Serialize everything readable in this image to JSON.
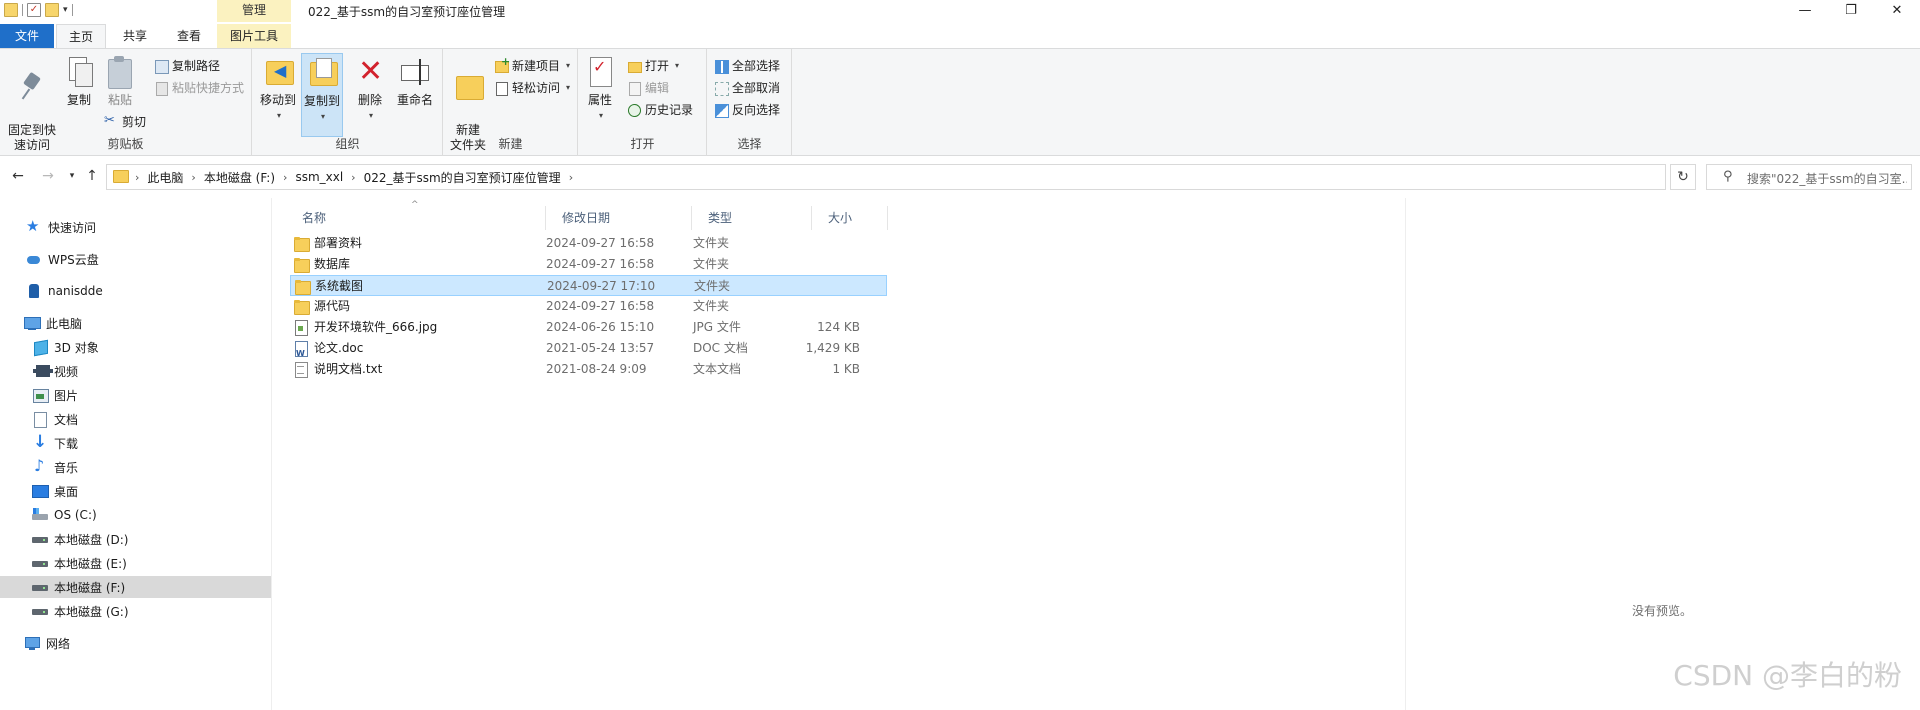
{
  "window": {
    "title": "022_基于ssm的自习室预订座位管理",
    "context_tab_group": "管理",
    "controls": {
      "minimize": "—",
      "maximize": "❐",
      "close": "✕"
    }
  },
  "ribbon_tabs": [
    {
      "label": "文件"
    },
    {
      "label": "主页"
    },
    {
      "label": "共享"
    },
    {
      "label": "查看"
    },
    {
      "label": "图片工具"
    }
  ],
  "ribbon": {
    "clipboard": {
      "label": "剪贴板",
      "pin": "固定到快\n速访问",
      "copy": "复制",
      "paste": "粘贴",
      "copy_path": "复制路径",
      "paste_shortcut": "粘贴快捷方式",
      "cut": "剪切"
    },
    "organize": {
      "label": "组织",
      "move_to": "移动到",
      "copy_to": "复制到",
      "delete": "删除",
      "rename": "重命名"
    },
    "new": {
      "label": "新建",
      "new_folder": "新建\n文件夹",
      "new_item": "新建项目",
      "easy_access": "轻松访问"
    },
    "open": {
      "label": "打开",
      "properties": "属性",
      "open": "打开",
      "edit": "编辑",
      "history": "历史记录"
    },
    "select": {
      "label": "选择",
      "select_all": "全部选择",
      "select_none": "全部取消",
      "invert": "反向选择"
    }
  },
  "address": {
    "crumbs": [
      "此电脑",
      "本地磁盘 (F:)",
      "ssm_xxl",
      "022_基于ssm的自习室预订座位管理"
    ],
    "search_placeholder": "搜索\"022_基于ssm的自习室..."
  },
  "nav_pane": {
    "items": [
      {
        "label": "快速访问",
        "icon": "star-icon"
      },
      {
        "label": "WPS云盘",
        "icon": "cloud-icon"
      },
      {
        "label": "nanisdde",
        "icon": "user-folder-icon"
      },
      {
        "label": "此电脑",
        "icon": "computer-icon"
      },
      {
        "label": "3D 对象",
        "icon": "3d-objects-icon"
      },
      {
        "label": "视频",
        "icon": "video-icon"
      },
      {
        "label": "图片",
        "icon": "pictures-icon"
      },
      {
        "label": "文档",
        "icon": "documents-icon"
      },
      {
        "label": "下载",
        "icon": "download-icon"
      },
      {
        "label": "音乐",
        "icon": "music-icon"
      },
      {
        "label": "桌面",
        "icon": "desktop-icon"
      },
      {
        "label": "OS (C:)",
        "icon": "os-drive-icon"
      },
      {
        "label": "本地磁盘 (D:)",
        "icon": "drive-icon"
      },
      {
        "label": "本地磁盘 (E:)",
        "icon": "drive-icon"
      },
      {
        "label": "本地磁盘 (F:)",
        "icon": "drive-icon"
      },
      {
        "label": "本地磁盘 (G:)",
        "icon": "drive-icon"
      },
      {
        "label": "网络",
        "icon": "network-icon"
      }
    ],
    "selected": "本地磁盘 (F:)"
  },
  "file_list": {
    "columns": {
      "name": "名称",
      "date": "修改日期",
      "type": "类型",
      "size": "大小"
    },
    "rows": [
      {
        "name": "部署资料",
        "date": "2024-09-27 16:58",
        "type": "文件夹",
        "size": "",
        "icon": "folder-icon"
      },
      {
        "name": "数据库",
        "date": "2024-09-27 16:58",
        "type": "文件夹",
        "size": "",
        "icon": "folder-icon"
      },
      {
        "name": "系统截图",
        "date": "2024-09-27 17:10",
        "type": "文件夹",
        "size": "",
        "icon": "folder-icon"
      },
      {
        "name": "源代码",
        "date": "2024-09-27 16:58",
        "type": "文件夹",
        "size": "",
        "icon": "folder-icon"
      },
      {
        "name": "开发环境软件_666.jpg",
        "date": "2024-06-26 15:10",
        "type": "JPG 文件",
        "size": "124 KB",
        "icon": "jpg-file-icon"
      },
      {
        "name": "论文.doc",
        "date": "2021-05-24 13:57",
        "type": "DOC 文档",
        "size": "1,429 KB",
        "icon": "doc-file-icon"
      },
      {
        "name": "说明文档.txt",
        "date": "2021-08-24 9:09",
        "type": "文本文档",
        "size": "1 KB",
        "icon": "txt-file-icon"
      }
    ],
    "selected": "系统截图"
  },
  "preview": {
    "empty_text": "没有预览。"
  },
  "watermark": "CSDN @李白的粉"
}
